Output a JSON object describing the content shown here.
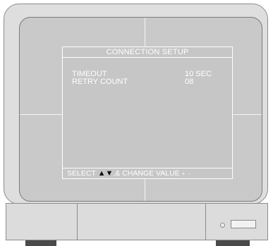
{
  "osd": {
    "title": "CONNECTION SETUP",
    "settings": [
      {
        "label": "TIMEOUT",
        "value": "10 SEC"
      },
      {
        "label": "RETRY COUNT",
        "value": "08"
      }
    ],
    "footer": {
      "select_text": "SELECT",
      "arrows": "▲▼",
      "change_text": ",& CHANGE VALUE",
      "change_keys": "+ -"
    }
  },
  "colors": {
    "screen": "#c9c9c9",
    "osd_text": "#ffffff",
    "bezel": "#dedede"
  }
}
